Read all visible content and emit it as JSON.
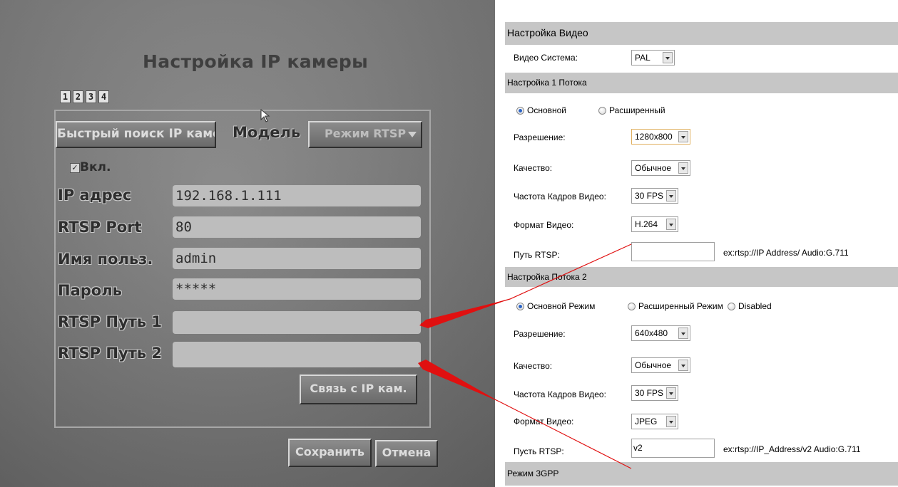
{
  "dvr": {
    "title": "Настройка IP камеры",
    "tabs": [
      "1",
      "2",
      "3",
      "4"
    ],
    "quick_search_button": "Быстрый поиск IP камер",
    "model_label": "Модель",
    "mode_select": "Режим RTSP",
    "enable_checkbox": "Вкл.",
    "fields": [
      {
        "label": "IP адрес",
        "value": "192.168.1.111"
      },
      {
        "label": "RTSP Port",
        "value": "80"
      },
      {
        "label": "Имя польз.",
        "value": "admin"
      },
      {
        "label": "Пароль",
        "value": "*****"
      },
      {
        "label": "RTSP Путь 1",
        "value": ""
      },
      {
        "label": "RTSP Путь 2",
        "value": ""
      }
    ],
    "connect_button": "Связь с IP кам.",
    "save_button": "Сохранить",
    "cancel_button": "Отмена"
  },
  "web": {
    "video_section": "Настройка Видео",
    "video_system_label": "Видео Система:",
    "video_system_value": "PAL",
    "stream1": {
      "section": "Настройка 1 Потока",
      "radio_basic": "Основной",
      "radio_extended": "Расширенный",
      "resolution_label": "Разрешение:",
      "resolution_value": "1280x800",
      "quality_label": "Качество:",
      "quality_value": "Обычное",
      "fps_label": "Частота Кадров Видео:",
      "fps_value": "30 FPS",
      "format_label": "Формат Видео:",
      "format_value": "H.264",
      "rtsp_label": "Путь RTSP:",
      "rtsp_value": "",
      "rtsp_hint": "ex:rtsp://IP  Address/   Audio:G.711"
    },
    "stream2": {
      "section": "Настройка Потока 2",
      "radio_basic": "Основной Режим",
      "radio_extended": "Расширенный Режим",
      "radio_disabled": "Disabled",
      "resolution_label": "Разрешение:",
      "resolution_value": "640x480",
      "quality_label": "Качество:",
      "quality_value": "Обычное",
      "fps_label": "Частота Кадров Видео:",
      "fps_value": "30 FPS",
      "format_label": "Формат Видео:",
      "format_value": "JPEG",
      "rtsp_label": "Пусть RTSP:",
      "rtsp_value": "v2",
      "rtsp_hint": "ex:rtsp://IP_Address/v2   Audio:G.711"
    },
    "gpp_section": "Режим 3GPP"
  },
  "colors": {
    "arrow": "#e01010",
    "section_bg": "#c6c6c6",
    "radio_dot": "#2a63c6"
  }
}
